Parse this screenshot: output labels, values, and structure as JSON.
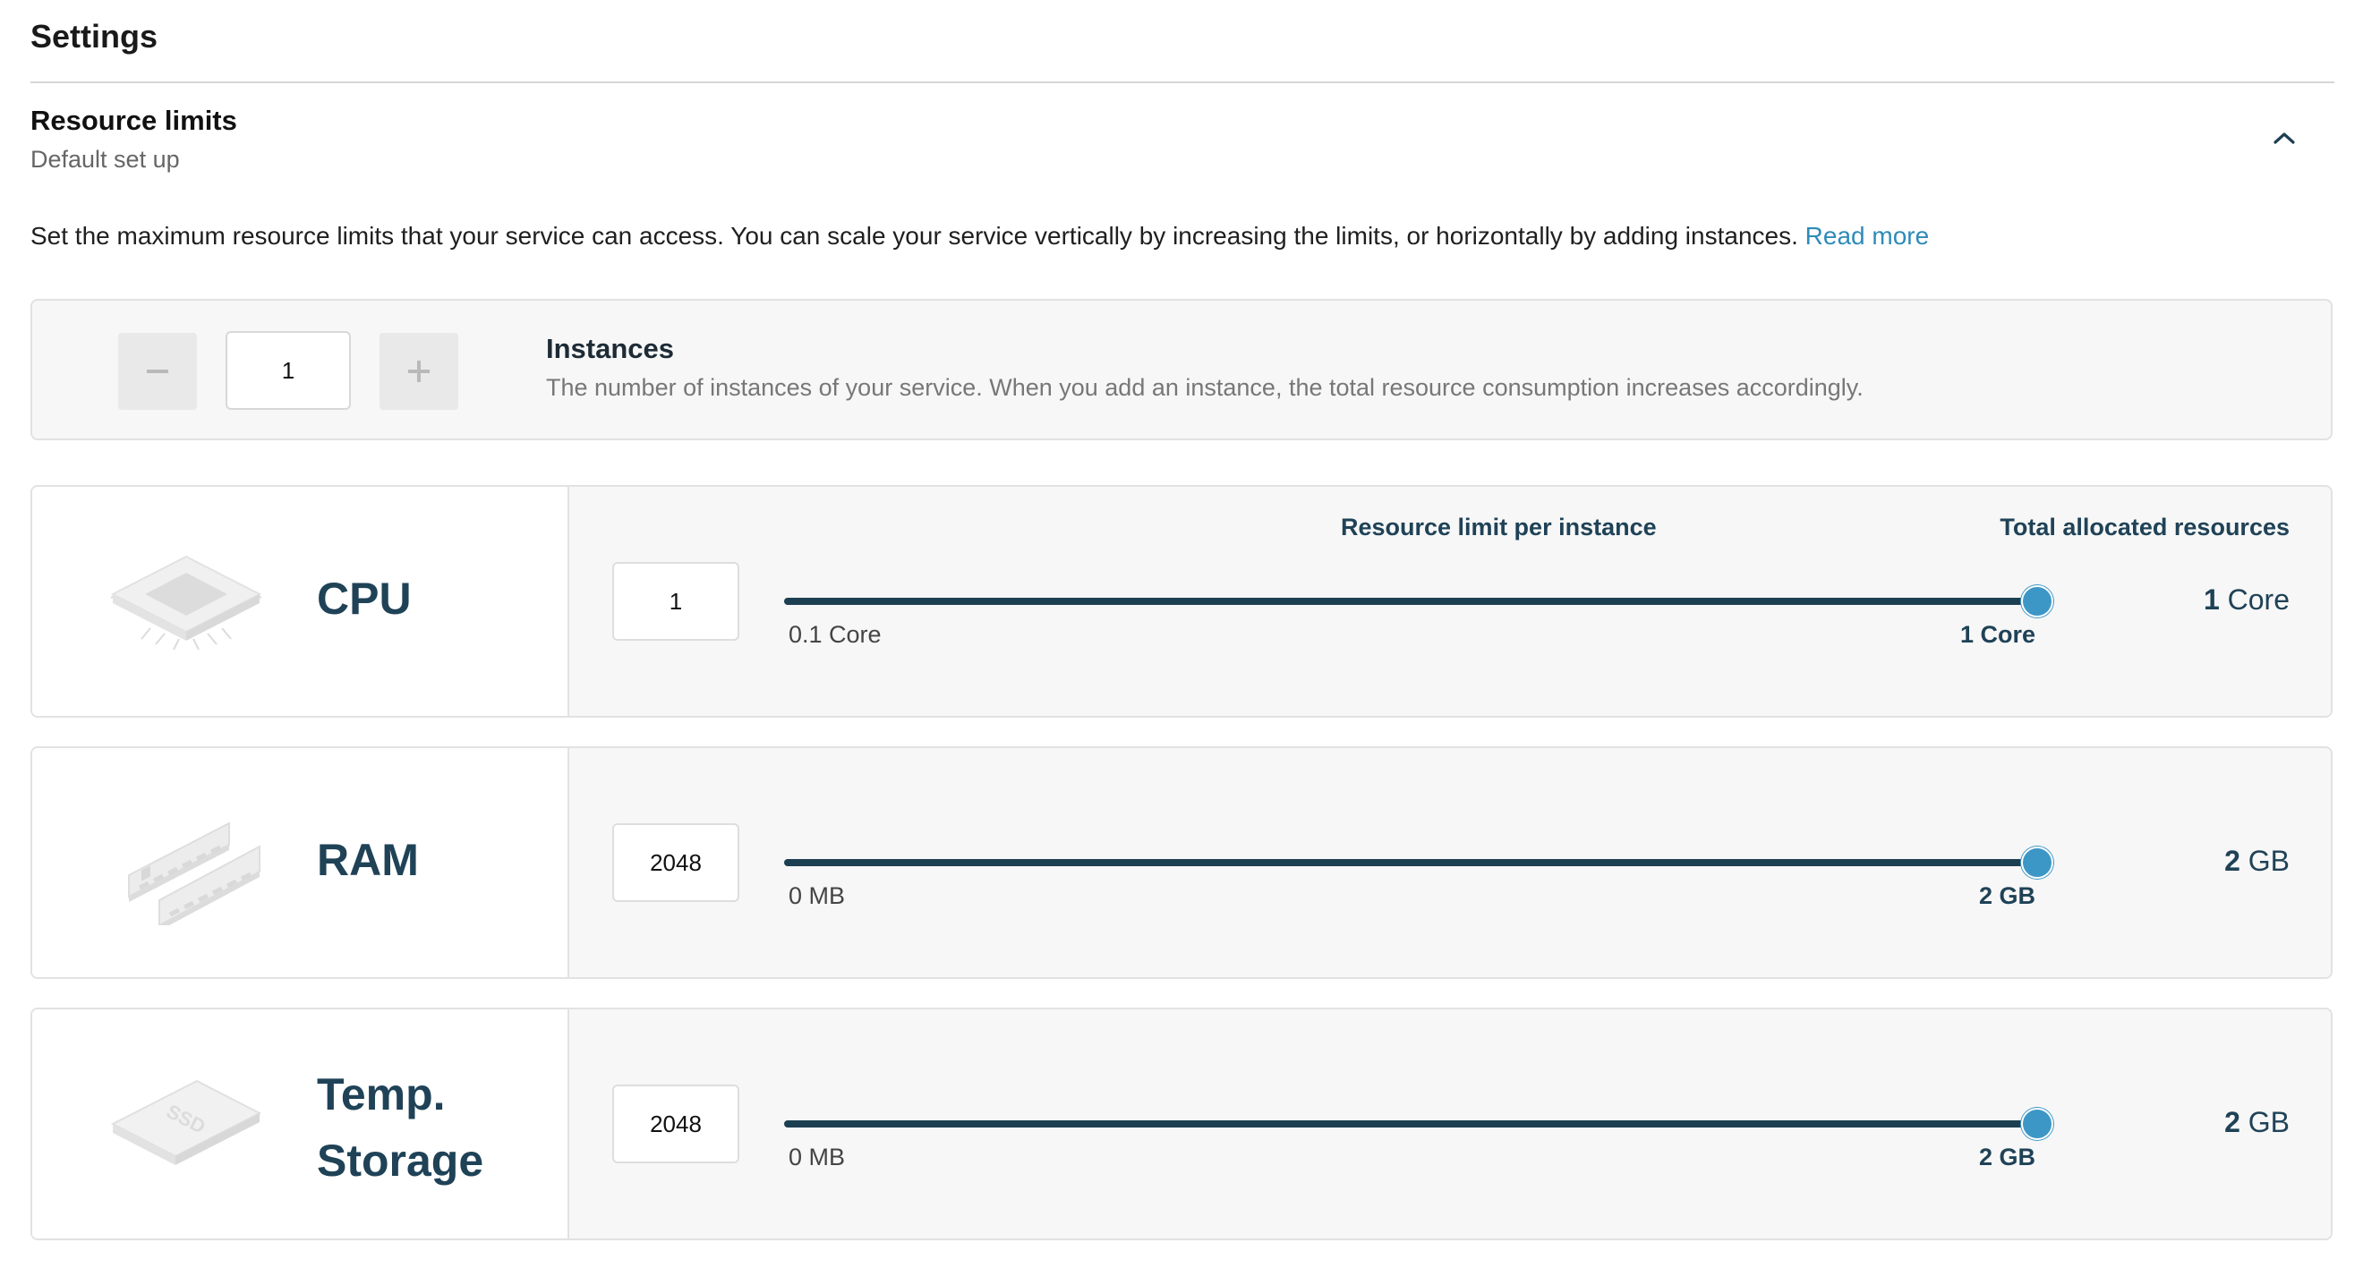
{
  "header": {
    "title": "Settings"
  },
  "section": {
    "title": "Resource limits",
    "subtitle": "Default set up",
    "description": "Set the maximum resource limits that your service can access. You can scale your service vertically by increasing the limits, or horizontally by adding instances.",
    "read_more": "Read more"
  },
  "instances": {
    "value": "1",
    "label": "Instances",
    "description": "The number of instances of your service. When you add an instance, the total resource consumption increases accordingly."
  },
  "columns": {
    "per_instance": "Resource limit per instance",
    "total": "Total allocated resources"
  },
  "resources": [
    {
      "name_line1": "CPU",
      "name_line2": "",
      "icon": "cpu-chip-icon",
      "value": "1",
      "min_label": "0.1 Core",
      "max_label": "1 Core",
      "slider_level": 1.0,
      "total_value": "1",
      "total_unit": "Core"
    },
    {
      "name_line1": "RAM",
      "name_line2": "",
      "icon": "ram-module-icon",
      "value": "2048",
      "min_label": "0 MB",
      "max_label": "2 GB",
      "slider_level": 1.0,
      "total_value": "2",
      "total_unit": "GB"
    },
    {
      "name_line1": "Temp.",
      "name_line2": "Storage",
      "icon": "ssd-drive-icon",
      "icon_text": "SSD",
      "value": "2048",
      "min_label": "0 MB",
      "max_label": "2 GB",
      "slider_level": 1.0,
      "total_value": "2",
      "total_unit": "GB"
    }
  ],
  "colors": {
    "accent": "#2e8bb8",
    "track": "#1d3f52",
    "thumb": "#3d97c6",
    "heading": "#1f4257"
  }
}
